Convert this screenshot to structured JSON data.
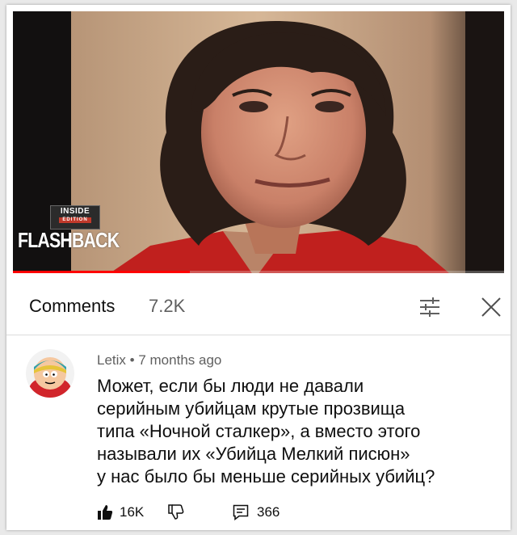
{
  "video": {
    "badge_top": "INSIDE",
    "badge_bottom": "EDITION",
    "show_name": "FLASHBACK",
    "progress": 0.36
  },
  "comments": {
    "title": "Comments",
    "count": "7.2K",
    "filter_icon": "sliders-icon",
    "close_icon": "close-icon"
  },
  "comment": {
    "author": "Letix",
    "separator": "•",
    "time": "7 months ago",
    "text_lines": [
      "Может, если бы люди не давали",
      "серийным убийцам крутые прозвища",
      "типа «Ночной сталкер», а вместо этого",
      "называли их «Убийца Мелкий писюн»",
      "у нас было бы меньше серийных убийц?"
    ],
    "likes": "16K",
    "replies": "366"
  },
  "colors": {
    "accent": "#ff0000",
    "text_primary": "#0f0f0f",
    "text_secondary": "#606060"
  }
}
